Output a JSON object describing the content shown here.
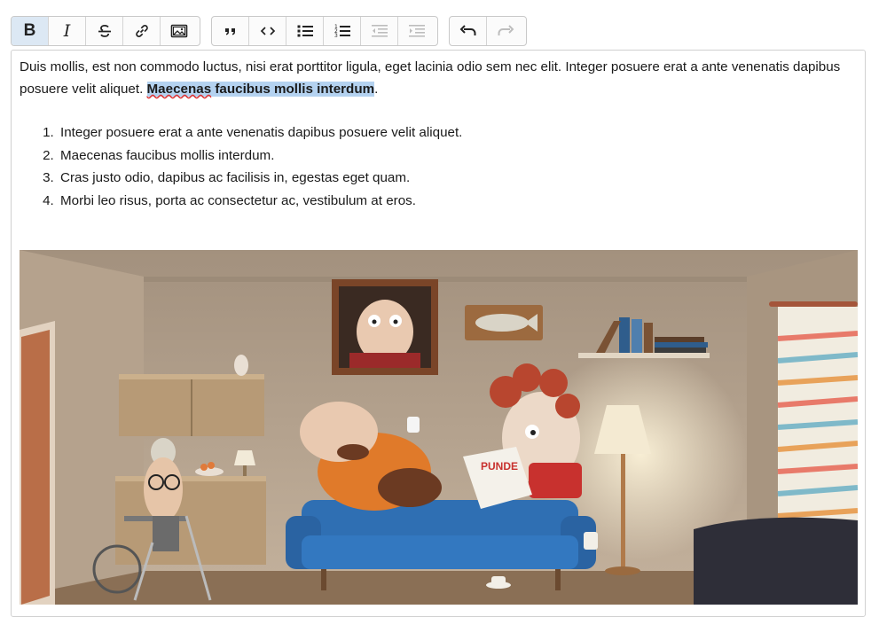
{
  "toolbar": {
    "groups": [
      [
        {
          "name": "bold",
          "icon": "bold-icon",
          "active": true
        },
        {
          "name": "italic",
          "icon": "italic-icon"
        },
        {
          "name": "strikethrough",
          "icon": "strikethrough-icon"
        },
        {
          "name": "link",
          "icon": "link-icon"
        },
        {
          "name": "image",
          "icon": "image-icon"
        }
      ],
      [
        {
          "name": "blockquote",
          "icon": "quote-icon"
        },
        {
          "name": "code",
          "icon": "code-icon"
        },
        {
          "name": "bullet-list",
          "icon": "bullet-list-icon"
        },
        {
          "name": "numbered-list",
          "icon": "numbered-list-icon"
        },
        {
          "name": "outdent",
          "icon": "outdent-icon",
          "disabled": true
        },
        {
          "name": "indent",
          "icon": "indent-icon",
          "disabled": true
        }
      ],
      [
        {
          "name": "undo",
          "icon": "undo-icon"
        },
        {
          "name": "redo",
          "icon": "redo-icon",
          "disabled": true
        }
      ]
    ],
    "bold_glyph": "B",
    "italic_glyph": "I"
  },
  "editor": {
    "paragraph_text": "Duis mollis, est non commodo luctus, nisi erat porttitor ligula, eget lacinia odio sem nec elit. Integer posuere erat a ante venenatis dapibus posuere velit aliquet. ",
    "selected_word": "Maecenas",
    "selected_rest": " faucibus mollis interdum",
    "paragraph_end": ".",
    "list_items": [
      "Integer posuere erat a ante venenatis dapibus posuere velit aliquet.",
      "Maecenas faucibus mollis interdum.",
      "Cras justo odio, dapibus ac facilisis in, egestas eget quam.",
      "Morbi leo risus, porta ac consectetur ac, vestibulum at eros."
    ],
    "image_magazine_text": "PUNDE",
    "colors": {
      "selection": "#b4d2f0",
      "active_button": "#dce8f4",
      "sofa": "#2f6fb3",
      "wall": "#bfae9a"
    }
  }
}
